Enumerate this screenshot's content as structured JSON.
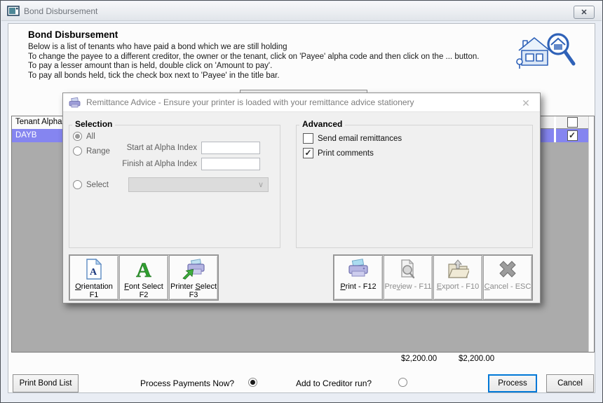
{
  "window": {
    "title": "Bond Disbursement",
    "heading": "Bond Disbursement",
    "instructions": [
      "Below is a list of tenants who have paid a bond which we are still holding",
      "To change the payee to a different creditor, the owner or the tenant, click on 'Payee' alpha code and then click on the ... button.",
      "To pay a lesser amount than is held, double click on 'Amount to pay'.",
      "To pay all bonds held, tick the check box next to 'Payee' in the title bar."
    ]
  },
  "icons": {
    "close_x": "✕",
    "chevron_down": "∨"
  },
  "table": {
    "header_tenant": "Tenant Alpha",
    "row": {
      "tenant_alpha": "DAYB",
      "checked": true
    }
  },
  "totals": {
    "amount_held": "$2,200.00",
    "amount_to_pay": "$2,200.00"
  },
  "footer": {
    "print_bond_list": "Print Bond List",
    "process_payments_label": "Process Payments Now?",
    "add_creditor_label": "Add to Creditor run?",
    "process": "Process",
    "cancel": "Cancel"
  },
  "modal": {
    "title": "Remittance Advice - Ensure your printer is loaded with your remittance advice stationery",
    "selection": {
      "legend": "Selection",
      "all": "All",
      "range": "Range",
      "select": "Select",
      "start_label": "Start at Alpha Index",
      "finish_label": "Finish at Alpha Index",
      "start_value": "",
      "finish_value": "",
      "select_value": ""
    },
    "advanced": {
      "legend": "Advanced",
      "send_email": "Send email remittances",
      "print_comments": "Print comments"
    },
    "left_buttons": [
      {
        "pre": "",
        "u": "O",
        "rest": "rientation",
        "line2": "F1"
      },
      {
        "pre": "",
        "u": "F",
        "rest": "ont Select",
        "line2": "F2"
      },
      {
        "pre": "Printer ",
        "u": "S",
        "rest": "elect",
        "line2": "F3"
      }
    ],
    "right_buttons": [
      {
        "pre": "",
        "u": "P",
        "rest": "rint - F12"
      },
      {
        "pre": "Pre",
        "u": "v",
        "rest": "iew - F11"
      },
      {
        "pre": "",
        "u": "E",
        "rest": "xport - F10"
      },
      {
        "pre": "",
        "u": "C",
        "rest": "ancel - ESC"
      }
    ]
  },
  "colors": {
    "accent_blue": "#0078d7",
    "row_highlight": "#8585f0",
    "grid_empty": "#ababab",
    "modal_bg": "#f0f0f0",
    "logo_blue": "#2f62b8"
  }
}
